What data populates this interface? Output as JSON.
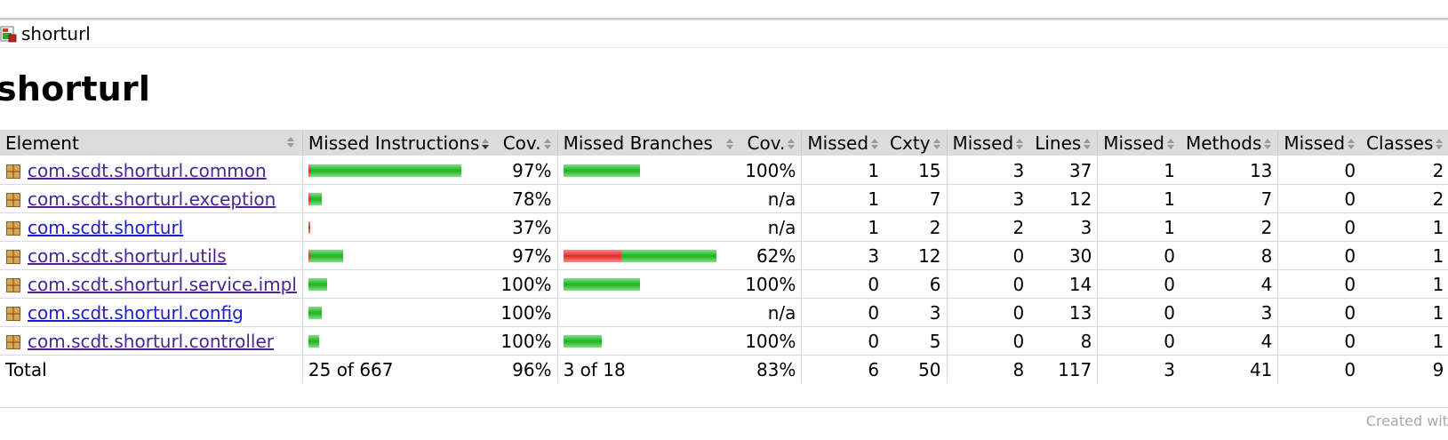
{
  "breadcrumb": {
    "label": "shorturl",
    "icon": "report-icon"
  },
  "page_title": "shorturl",
  "table": {
    "headers": {
      "element": "Element",
      "missed_instructions": "Missed Instructions",
      "cov1": "Cov.",
      "missed_branches": "Missed Branches",
      "cov2": "Cov.",
      "missed_cxty": "Missed",
      "cxty": "Cxty",
      "missed_lines": "Missed",
      "lines": "Lines",
      "missed_methods": "Missed",
      "methods": "Methods",
      "missed_classes": "Missed",
      "classes": "Classes"
    },
    "rows": [
      {
        "name": "com.scdt.shorturl.common",
        "instr_red": 0.02,
        "instr_green": 0.98,
        "instr_scale": 1.0,
        "instr_cov": "97%",
        "br_red": 0,
        "br_green": 1,
        "br_scale": 0.5,
        "br_cov": "100%",
        "m_cxty": "1",
        "cxty": "15",
        "m_lines": "3",
        "lines": "37",
        "m_methods": "1",
        "methods": "13",
        "m_classes": "0",
        "classes": "2"
      },
      {
        "name": "com.scdt.shorturl.exception",
        "instr_red": 0.22,
        "instr_green": 0.78,
        "instr_scale": 0.09,
        "instr_cov": "78%",
        "br_red": 0,
        "br_green": 0,
        "br_scale": 0,
        "br_cov": "n/a",
        "m_cxty": "1",
        "cxty": "7",
        "m_lines": "3",
        "lines": "12",
        "m_methods": "1",
        "methods": "7",
        "m_classes": "0",
        "classes": "2"
      },
      {
        "name": "com.scdt.shorturl",
        "instr_red": 0.63,
        "instr_green": 0.37,
        "instr_scale": 0.01,
        "instr_cov": "37%",
        "br_red": 0,
        "br_green": 0,
        "br_scale": 0,
        "br_cov": "n/a",
        "m_cxty": "1",
        "cxty": "2",
        "m_lines": "2",
        "lines": "3",
        "m_methods": "1",
        "methods": "2",
        "m_classes": "0",
        "classes": "1",
        "fresh": true
      },
      {
        "name": "com.scdt.shorturl.utils",
        "instr_red": 0.03,
        "instr_green": 0.97,
        "instr_scale": 0.22,
        "instr_cov": "97%",
        "br_red": 0.38,
        "br_green": 0.62,
        "br_scale": 1.0,
        "br_cov": "62%",
        "m_cxty": "3",
        "cxty": "12",
        "m_lines": "0",
        "lines": "30",
        "m_methods": "0",
        "methods": "8",
        "m_classes": "0",
        "classes": "1"
      },
      {
        "name": "com.scdt.shorturl.service.impl",
        "instr_red": 0,
        "instr_green": 1,
        "instr_scale": 0.12,
        "instr_cov": "100%",
        "br_red": 0,
        "br_green": 1,
        "br_scale": 0.5,
        "br_cov": "100%",
        "m_cxty": "0",
        "cxty": "6",
        "m_lines": "0",
        "lines": "14",
        "m_methods": "0",
        "methods": "4",
        "m_classes": "0",
        "classes": "1"
      },
      {
        "name": "com.scdt.shorturl.config",
        "instr_red": 0,
        "instr_green": 1,
        "instr_scale": 0.09,
        "instr_cov": "100%",
        "br_red": 0,
        "br_green": 0,
        "br_scale": 0,
        "br_cov": "n/a",
        "m_cxty": "0",
        "cxty": "3",
        "m_lines": "0",
        "lines": "13",
        "m_methods": "0",
        "methods": "3",
        "m_classes": "0",
        "classes": "1",
        "fresh": true
      },
      {
        "name": "com.scdt.shorturl.controller",
        "instr_red": 0,
        "instr_green": 1,
        "instr_scale": 0.07,
        "instr_cov": "100%",
        "br_red": 0,
        "br_green": 1,
        "br_scale": 0.25,
        "br_cov": "100%",
        "m_cxty": "0",
        "cxty": "5",
        "m_lines": "0",
        "lines": "8",
        "m_methods": "0",
        "methods": "4",
        "m_classes": "0",
        "classes": "1"
      }
    ],
    "total": {
      "label": "Total",
      "instr": "25 of 667",
      "instr_cov": "96%",
      "br": "3 of 18",
      "br_cov": "83%",
      "m_cxty": "6",
      "cxty": "50",
      "m_lines": "8",
      "lines": "117",
      "m_methods": "3",
      "methods": "41",
      "m_classes": "0",
      "classes": "9"
    }
  },
  "footer": {
    "text": "Created wit"
  },
  "colors": {
    "header_bg": "#dcdcdc",
    "link_visited": "#4b2495",
    "link": "#1c1cd1",
    "bar_red": "#e02c2c",
    "bar_green": "#1fae1f"
  }
}
